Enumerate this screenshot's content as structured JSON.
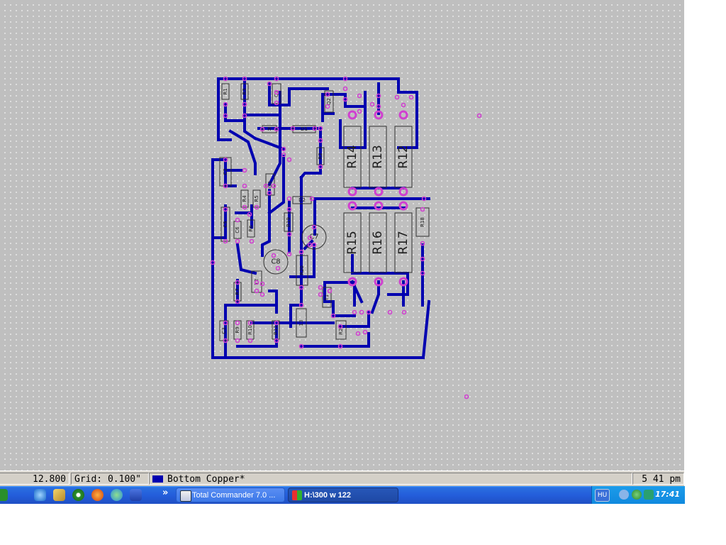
{
  "status": {
    "coord": "12.800",
    "grid": "Grid: 0.100\"",
    "layer": "Bottom Copper*",
    "time_right": "5 41 pm",
    "layer_color": "#0000b0"
  },
  "taskbar": {
    "quicklaunch": [
      "internet-explorer-icon",
      "tools-icon",
      "media-player-icon",
      "firefox-icon",
      "messenger-icon",
      "floppy-disk-icon"
    ],
    "chevron": "»",
    "tasks": [
      {
        "label": "Total Commander 7.0 ...",
        "icon": "total-commander-icon"
      },
      {
        "label": "H:\\300 w 122",
        "icon": "pcb-app-icon"
      }
    ],
    "tray": {
      "language": "HU",
      "clock": "17:41"
    }
  },
  "board": {
    "trace_color": "#0000b0",
    "pad_color": "#d040d0",
    "components": [
      {
        "ref": "R14",
        "large": true
      },
      {
        "ref": "R13",
        "large": true
      },
      {
        "ref": "R12",
        "large": true
      },
      {
        "ref": "R15",
        "large": true
      },
      {
        "ref": "R16",
        "large": true
      },
      {
        "ref": "R17",
        "large": true
      },
      {
        "ref": "R18"
      },
      {
        "ref": "R20"
      },
      {
        "ref": "C2"
      },
      {
        "ref": "C7"
      },
      {
        "ref": "C8"
      },
      {
        "ref": "R1"
      },
      {
        "ref": "R3"
      },
      {
        "ref": "R2"
      },
      {
        "ref": "R4"
      },
      {
        "ref": "R5"
      },
      {
        "ref": "R6"
      },
      {
        "ref": "R7"
      },
      {
        "ref": "R9"
      },
      {
        "ref": "R10"
      },
      {
        "ref": "R11"
      },
      {
        "ref": "R19"
      },
      {
        "ref": "R21"
      },
      {
        "ref": "D1"
      },
      {
        "ref": "D2"
      },
      {
        "ref": "Q1"
      },
      {
        "ref": "Q2"
      },
      {
        "ref": "Q3"
      },
      {
        "ref": "C3"
      },
      {
        "ref": "C5"
      },
      {
        "ref": "C6"
      },
      {
        "ref": "13"
      },
      {
        "ref": "T1"
      },
      {
        "ref": "T2"
      },
      {
        "ref": "R"
      }
    ]
  }
}
